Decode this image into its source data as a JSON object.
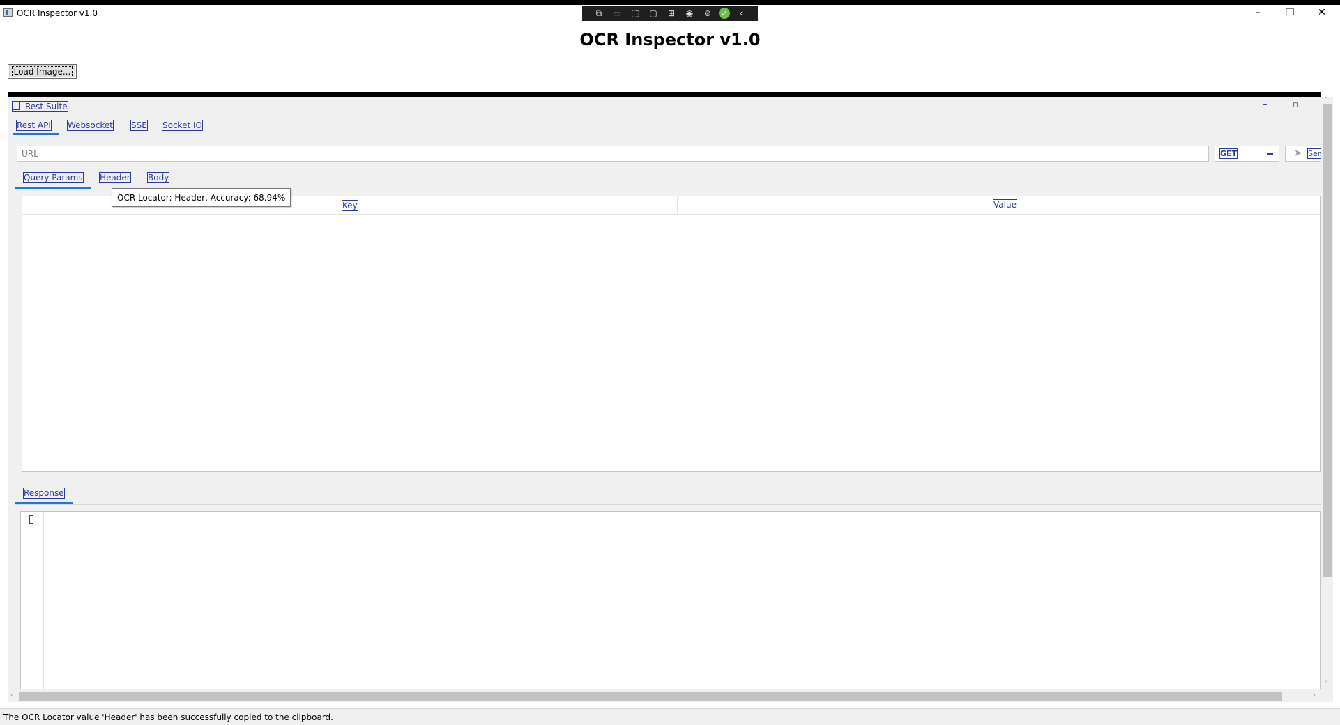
{
  "window": {
    "title": "OCR Inspector v1.0",
    "minimize_glyph": "–",
    "maximize_glyph": "❐",
    "close_glyph": "✕"
  },
  "toolbar_icons": [
    "inspect-icon",
    "record-icon",
    "select-icon",
    "frame-icon",
    "tree-icon",
    "eye-icon",
    "accessibility-icon",
    "check-icon",
    "collapse-icon"
  ],
  "heading": "OCR Inspector v1.0",
  "load_button": "Load Image...",
  "inner_window": {
    "title": "Rest Suite",
    "minimize_glyph": "–",
    "maximize_glyph": "▫"
  },
  "tabs": [
    "Rest API",
    "Websocket",
    "SSE",
    "Socket IO"
  ],
  "url_input": {
    "placeholder": "URL",
    "value": ""
  },
  "method": {
    "selected": "GET"
  },
  "send_button": "Sen",
  "subtabs": [
    "Query Params",
    "Header",
    "Body"
  ],
  "grid": {
    "columns": [
      "Key",
      "Value"
    ]
  },
  "tooltip": "OCR Locator: Header, Accuracy: 68.94%",
  "response_tab": "Response",
  "status": "The OCR Locator value 'Header' has been successfully copied to the clipboard.",
  "accent_color": "#1e78d2",
  "ocr_highlight_color": "#2b3aa0"
}
